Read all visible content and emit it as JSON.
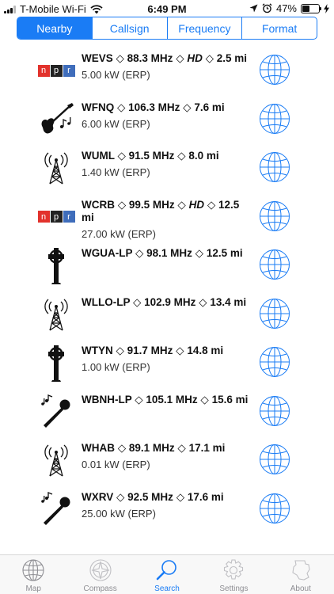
{
  "status_bar": {
    "carrier": "T-Mobile Wi-Fi",
    "time": "6:49 PM",
    "battery": "47%",
    "battery_level": 0.47
  },
  "segments": [
    {
      "label": "Nearby",
      "active": true
    },
    {
      "label": "Callsign",
      "active": false
    },
    {
      "label": "Frequency",
      "active": false
    },
    {
      "label": "Format",
      "active": false
    }
  ],
  "stations": [
    {
      "callsign": "WEVS",
      "freq": "88.3 MHz",
      "hd": "HD",
      "dist": "2.5 mi",
      "erp": "5.00 kW (ERP)",
      "icon": "npr-logo-icon"
    },
    {
      "callsign": "WFNQ",
      "freq": "106.3 MHz",
      "dist": "7.6 mi",
      "erp": "6.00 kW (ERP)",
      "icon": "guitar-icon"
    },
    {
      "callsign": "WUML",
      "freq": "91.5 MHz",
      "dist": "8.0 mi",
      "erp": "1.40 kW (ERP)",
      "icon": "radio-tower-icon"
    },
    {
      "callsign": "WCRB",
      "freq": "99.5 MHz",
      "hd": "HD",
      "dist": "12.5 mi",
      "erp": "27.00 kW (ERP)",
      "icon": "npr-logo-icon"
    },
    {
      "callsign": "WGUA-LP",
      "freq": "98.1 MHz",
      "dist": "12.5 mi",
      "erp": "",
      "icon": "celtic-cross-icon"
    },
    {
      "callsign": "WLLO-LP",
      "freq": "102.9 MHz",
      "dist": "13.4 mi",
      "erp": "",
      "icon": "radio-tower-icon"
    },
    {
      "callsign": "WTYN",
      "freq": "91.7 MHz",
      "dist": "14.8 mi",
      "erp": "1.00 kW (ERP)",
      "icon": "celtic-cross-icon"
    },
    {
      "callsign": "WBNH-LP",
      "freq": "105.1 MHz",
      "dist": "15.6 mi",
      "erp": "",
      "icon": "microphone-icon"
    },
    {
      "callsign": "WHAB",
      "freq": "89.1 MHz",
      "dist": "17.1 mi",
      "erp": "0.01 kW (ERP)",
      "icon": "radio-tower-icon"
    },
    {
      "callsign": "WXRV",
      "freq": "92.5 MHz",
      "dist": "17.6 mi",
      "erp": "25.00 kW (ERP)",
      "icon": "microphone-icon"
    }
  ],
  "tabs": [
    {
      "label": "Map",
      "icon": "globe-icon",
      "active": false
    },
    {
      "label": "Compass",
      "icon": "compass-icon",
      "active": false
    },
    {
      "label": "Search",
      "icon": "magnifier-icon",
      "active": true
    },
    {
      "label": "Settings",
      "icon": "gear-icon",
      "active": false
    },
    {
      "label": "About",
      "icon": "state-map-icon",
      "active": false
    }
  ],
  "colors": {
    "accent": "#1a7cf5",
    "npr_red": "#e2322c",
    "npr_black": "#222222",
    "npr_blue": "#3f6dbb",
    "globe_outline": "#1a7cf5"
  }
}
